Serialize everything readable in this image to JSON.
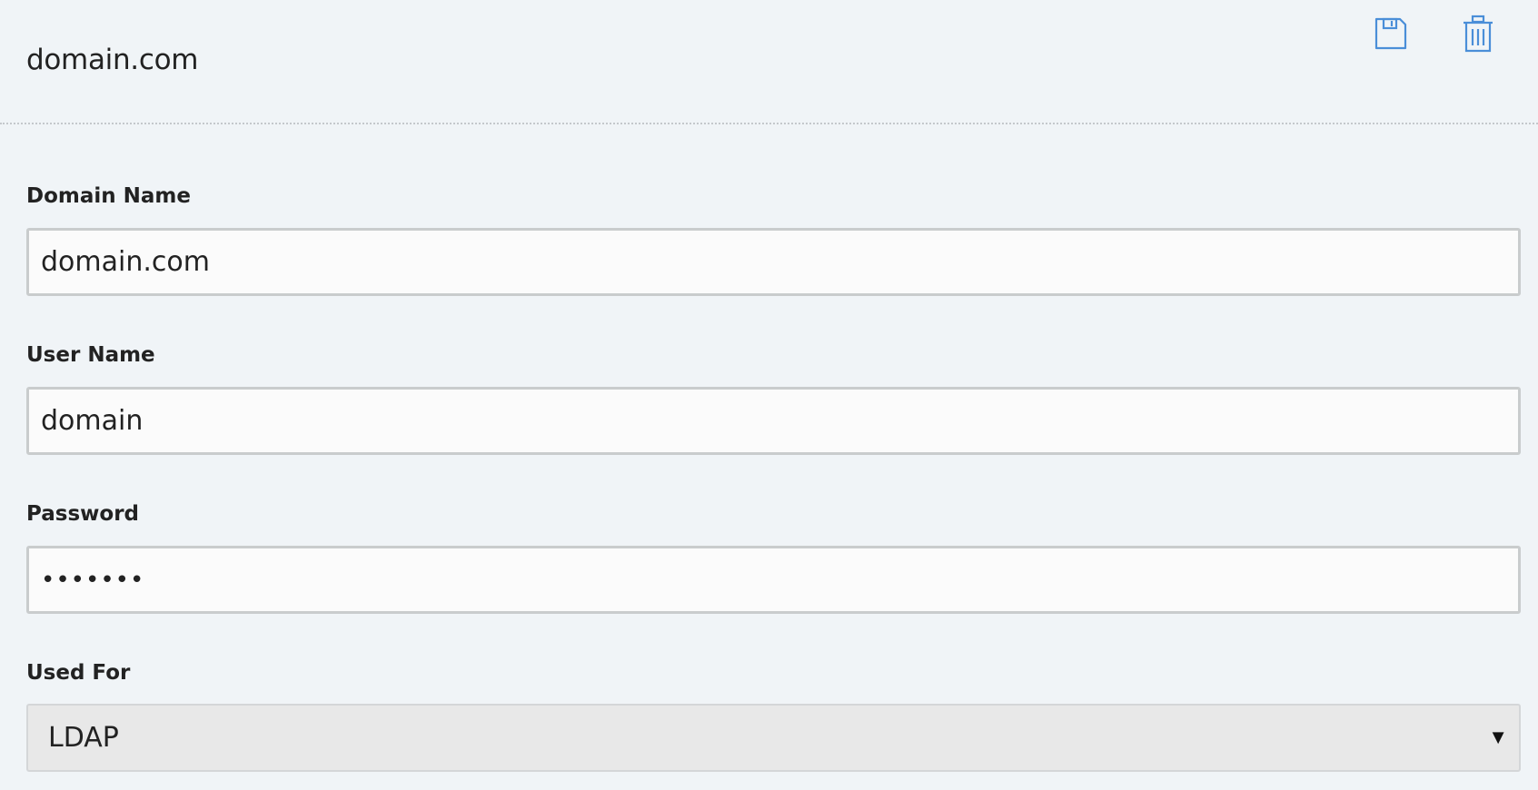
{
  "header": {
    "title": "domain.com",
    "actions": [
      {
        "icon": "save-icon",
        "color": "#4a8ed8"
      },
      {
        "icon": "trash-icon",
        "color": "#4a8ed8"
      }
    ]
  },
  "form": {
    "domain_name": {
      "label": "Domain Name",
      "value": "domain.com"
    },
    "user_name": {
      "label": "User Name",
      "value": "domain"
    },
    "password": {
      "label": "Password",
      "value": "•••••••"
    },
    "used_for": {
      "label": "Used For",
      "selected": "LDAP",
      "caret": "▼"
    }
  }
}
